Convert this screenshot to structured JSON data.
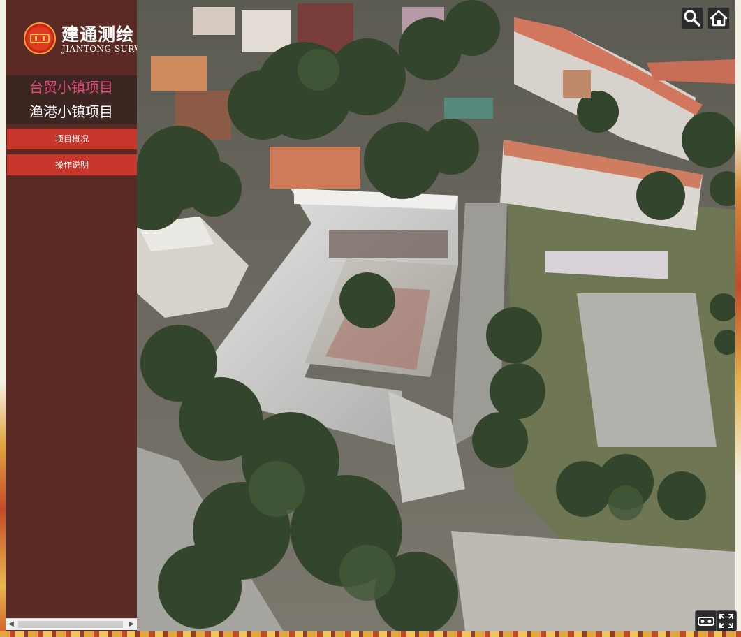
{
  "branding": {
    "company_cn": "建通测绘",
    "company_en": "JIANTONG SURVEY"
  },
  "projects": [
    {
      "label": "台贸小镇项目",
      "active": true
    },
    {
      "label": "渔港小镇项目",
      "active": false
    }
  ],
  "buttons": {
    "overview": "项目概况",
    "instructions": "操作说明"
  },
  "toolbar": {
    "search_icon": "search-icon",
    "home_icon": "home-icon",
    "vr_icon": "vr-glasses-icon",
    "fullscreen_icon": "fullscreen-icon"
  },
  "colors": {
    "sidebar_bg": "#5a2a24",
    "project_strip_bg": "#3b2622",
    "active_project": "#e04a78",
    "button_red": "#c8352a"
  }
}
